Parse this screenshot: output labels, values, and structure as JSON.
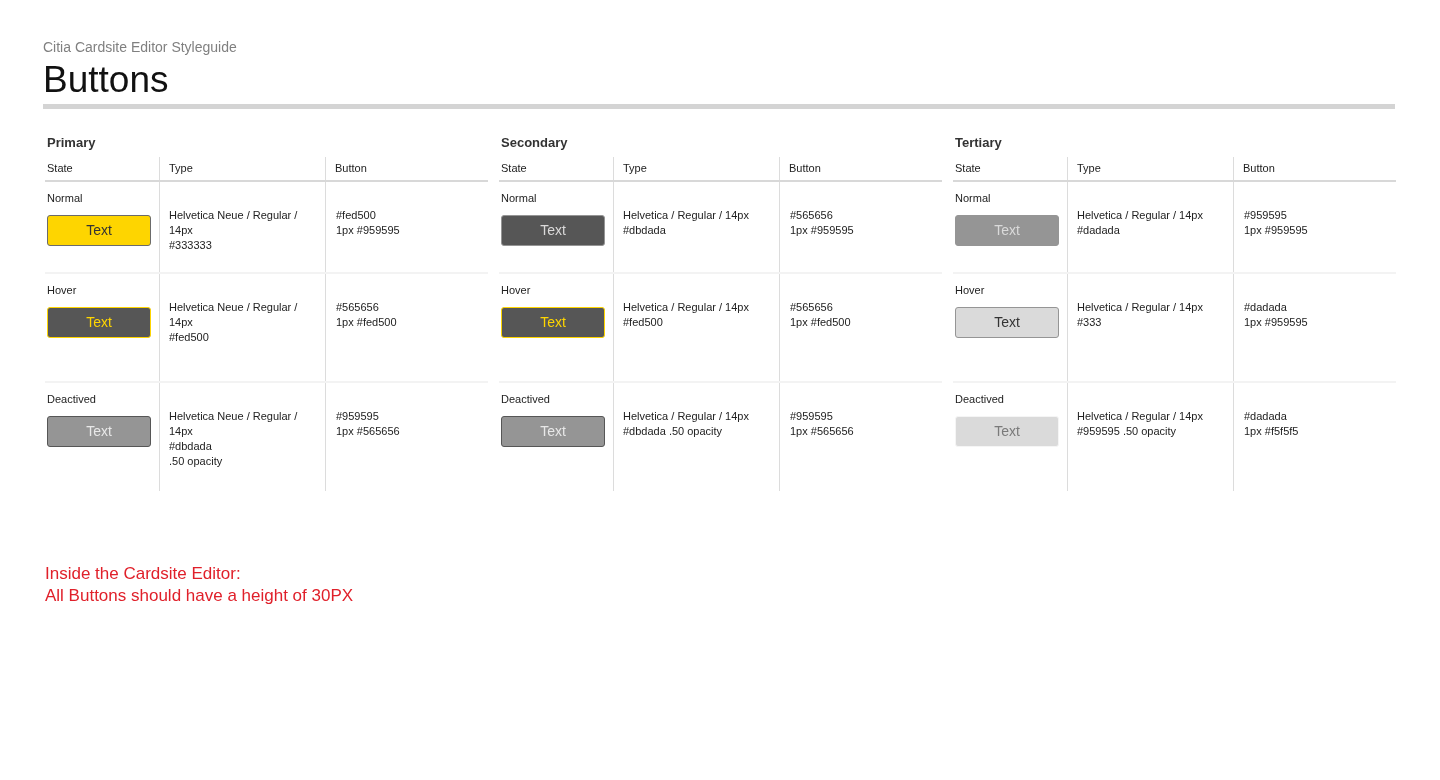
{
  "header": {
    "subtitle": "Citia Cardsite Editor Styleguide",
    "title": "Buttons"
  },
  "sections": [
    {
      "kind": "primary",
      "title": "Primary",
      "columns": [
        "State",
        "Type",
        "Button"
      ],
      "rows": [
        {
          "kind": "normal",
          "state_label": "Normal",
          "sample": "Text",
          "type_lines": [
            "Helvetica Neue / Regular / 14px",
            "#333333"
          ],
          "button_lines": [
            "#fed500",
            "1px #959595"
          ]
        },
        {
          "kind": "hover",
          "state_label": "Hover",
          "sample": "Text",
          "type_lines": [
            "Helvetica Neue / Regular / 14px",
            "#fed500"
          ],
          "button_lines": [
            "#565656",
            "1px #fed500"
          ]
        },
        {
          "kind": "deactivated",
          "state_label": "Deactived",
          "sample": "Text",
          "type_lines": [
            "Helvetica Neue / Regular / 14px",
            "#dbdada",
            ".50 opacity"
          ],
          "button_lines": [
            "#959595",
            "1px #565656"
          ]
        }
      ]
    },
    {
      "kind": "secondary",
      "title": "Secondary",
      "columns": [
        "State",
        "Type",
        "Button"
      ],
      "rows": [
        {
          "kind": "normal",
          "state_label": "Normal",
          "sample": "Text",
          "type_lines": [
            "Helvetica / Regular / 14px",
            "#dbdada"
          ],
          "button_lines": [
            "#565656",
            "1px #959595"
          ]
        },
        {
          "kind": "hover",
          "state_label": "Hover",
          "sample": "Text",
          "type_lines": [
            "Helvetica / Regular / 14px",
            "#fed500"
          ],
          "button_lines": [
            "#565656",
            "1px #fed500"
          ]
        },
        {
          "kind": "deactivated",
          "state_label": "Deactived",
          "sample": "Text",
          "type_lines": [
            "Helvetica / Regular / 14px",
            "#dbdada .50 opacity"
          ],
          "button_lines": [
            "#959595",
            "1px #565656"
          ]
        }
      ]
    },
    {
      "kind": "tertiary",
      "title": "Tertiary",
      "columns": [
        "State",
        "Type",
        "Button"
      ],
      "rows": [
        {
          "kind": "normal",
          "state_label": "Normal",
          "sample": "Text",
          "type_lines": [
            "Helvetica / Regular / 14px",
            "#dadada"
          ],
          "button_lines": [
            "#959595",
            "1px #959595"
          ]
        },
        {
          "kind": "hover",
          "state_label": "Hover",
          "sample": "Text",
          "type_lines": [
            "Helvetica / Regular / 14px",
            "#333"
          ],
          "button_lines": [
            "#dadada",
            "1px #959595"
          ]
        },
        {
          "kind": "deactivated",
          "state_label": "Deactived",
          "sample": "Text",
          "type_lines": [
            "Helvetica / Regular / 14px",
            "#959595 .50 opacity"
          ],
          "button_lines": [
            "#dadada",
            "1px #f5f5f5"
          ]
        }
      ]
    }
  ],
  "note": [
    "Inside the Cardsite Editor:",
    "All Buttons should have a height of 30PX"
  ]
}
